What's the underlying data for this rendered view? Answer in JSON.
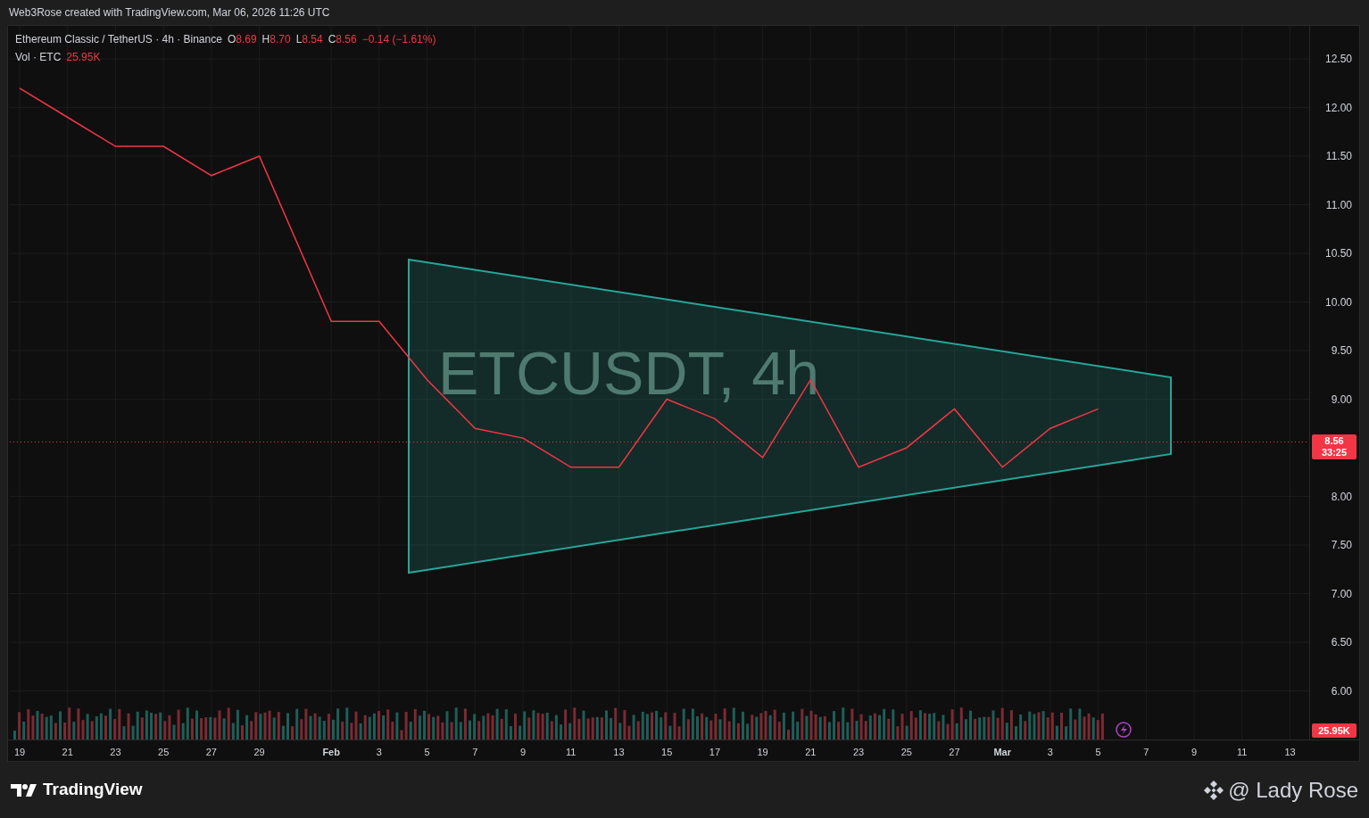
{
  "header": {
    "text": "Web3Rose created with TradingView.com, Mar 06, 2026 11:26 UTC"
  },
  "legend": {
    "symbol": "Ethereum Classic / TetherUS · 4h · Binance",
    "open_label": "O",
    "open": "8.69",
    "high_label": "H",
    "high": "8.70",
    "low_label": "L",
    "low": "8.54",
    "close_label": "C",
    "close": "8.56",
    "change": "−0.14 (−1.61%)",
    "volume_label": "Vol · ETC",
    "volume": "25.95K"
  },
  "watermark": "ETCUSDT, 4h",
  "price_label": {
    "price": "8.56",
    "countdown": "33:25"
  },
  "volume_label": "25.95K",
  "chart": {
    "chart_data": {
      "type": "line",
      "categories": [
        "19",
        "21",
        "23",
        "25",
        "27",
        "29",
        "Feb",
        "3",
        "5",
        "7",
        "9",
        "11",
        "13",
        "15",
        "17",
        "19",
        "21",
        "23",
        "25",
        "27",
        "Mar",
        "3",
        "5",
        "7",
        "9",
        "11",
        "13"
      ],
      "series": [
        {
          "color": "#f23645",
          "values": [
            12.2,
            11.9,
            11.6,
            11.6,
            11.3,
            11.5,
            9.8,
            9.8,
            9.2,
            8.7,
            8.6,
            8.3,
            8.3,
            9.0,
            8.8,
            8.4,
            9.2,
            8.3,
            8.5,
            8.9,
            8.3,
            8.7,
            8.9,
            null,
            null,
            null,
            null
          ]
        }
      ],
      "ylim": [
        5.5,
        12.84
      ],
      "grid": true,
      "ref_lines": [
        {
          "axis": "y",
          "value": 8.56,
          "color": "#f23645"
        }
      ],
      "yticks": [
        {
          "value": 12.5,
          "label": "12.50"
        },
        {
          "value": 12,
          "label": "12.00"
        },
        {
          "value": 11.5,
          "label": "11.50"
        },
        {
          "value": 11,
          "label": "11.00"
        },
        {
          "value": 10.5,
          "label": "10.50"
        },
        {
          "value": 10,
          "label": "10.00"
        },
        {
          "value": 9.5,
          "label": "9.50"
        },
        {
          "value": 9,
          "label": "9.00"
        },
        {
          "value": 8,
          "label": "8.00"
        },
        {
          "value": 7.5,
          "label": "7.50"
        },
        {
          "value": 7,
          "label": "7.00"
        },
        {
          "value": 6.5,
          "label": "6.50"
        },
        {
          "value": 6,
          "label": "6.00"
        }
      ]
    }
  },
  "footer": {
    "brand": "TradingView",
    "author": "@ Lady Rose"
  }
}
